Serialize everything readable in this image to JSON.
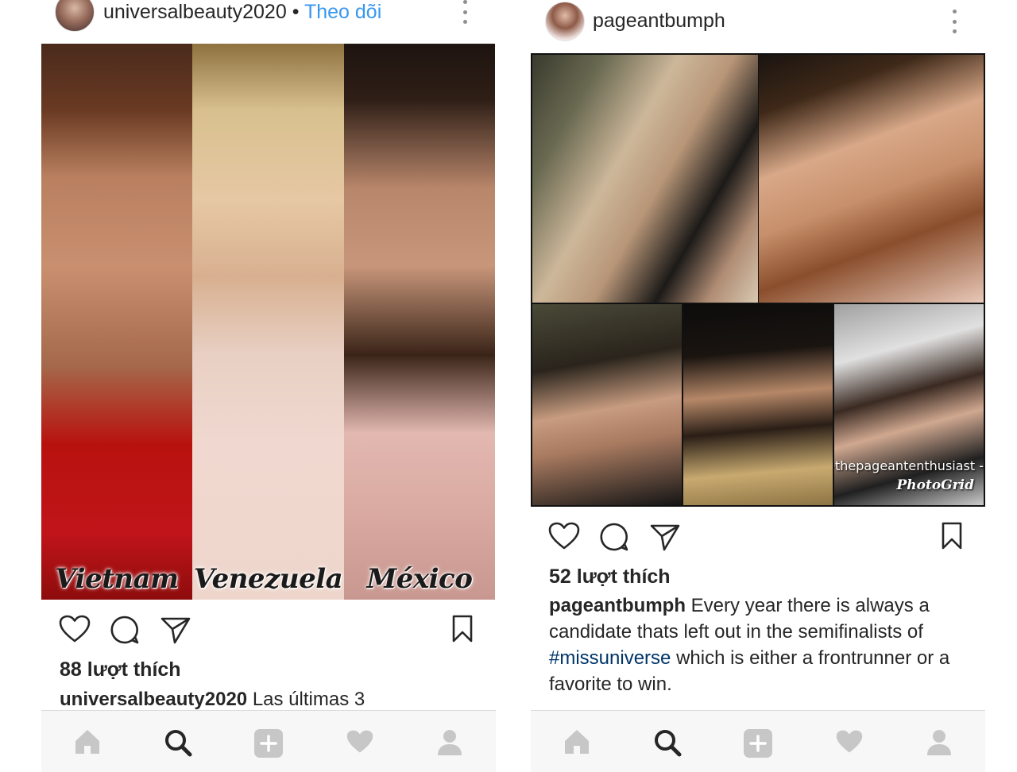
{
  "left_post": {
    "username": "universalbeauty2020",
    "separator": "•",
    "follow_label": "Theo dõi",
    "photo_captions": [
      "Vietnam",
      "Venezuela",
      "México"
    ],
    "likes": "88 lượt thích",
    "caption_user": "universalbeauty2020",
    "caption_text": "Las últimas 3"
  },
  "right_post": {
    "username": "pageantbumph",
    "watermark_line1": "-thepageantenthusiast -",
    "watermark_line2": "PhotoGrid",
    "likes": "52 lượt thích",
    "caption_user": "pageantbumph",
    "caption_text_1": "Every year there is always a candidate thats left out in the semifinalists of",
    "caption_hashtag": "#missuniverse",
    "caption_text_2": "which is either a frontrunner or a favorite to win."
  },
  "icons": {
    "like": "heart-outline-icon",
    "comment": "comment-bubble-icon",
    "share": "paper-plane-icon",
    "save": "bookmark-icon",
    "nav": [
      "home-icon",
      "search-icon",
      "add-icon",
      "activity-heart-icon",
      "profile-icon"
    ]
  },
  "colors": {
    "follow": "#3897f0",
    "hashtag": "#003569",
    "text": "#262626",
    "nav_background": "#f7f7f7",
    "nav_icon_inactive": "#c7c7c7"
  }
}
